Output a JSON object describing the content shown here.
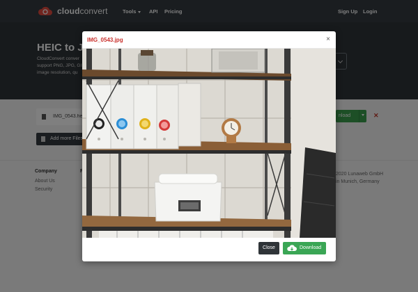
{
  "brand": {
    "name_bold": "cloud",
    "name_light": "convert"
  },
  "nav": {
    "tools": "Tools",
    "api": "API",
    "pricing": "Pricing",
    "signup": "Sign Up",
    "login": "Login"
  },
  "hero": {
    "title": "HEIC to JP",
    "text": "CloudConvert conver support PNG, JPG, GI image resolution, qu"
  },
  "job": {
    "file_name": "IMG_0543.he",
    "download_label": "nload",
    "remove_icon": "close-icon",
    "add_more_label": "Add more Files"
  },
  "footer": {
    "col1_heading": "Company",
    "col1_links": [
      "About Us",
      "Security"
    ],
    "col2_heading": "R",
    "copyright_line1": "2020 Lunaweb GmbH",
    "copyright_line2": "in Munich, Germany"
  },
  "modal": {
    "title": "IMG_0543.jpg",
    "close_icon": "×",
    "close_label": "Close",
    "download_label": "Download",
    "download_icon": "cloud-download-icon"
  },
  "colors": {
    "modal_title": "#c9302c",
    "download_green": "#3aa655",
    "dark_button": "#2f3438",
    "navbar": "#343a40"
  }
}
